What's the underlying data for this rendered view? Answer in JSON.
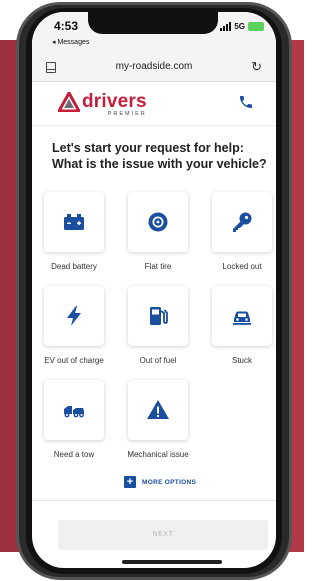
{
  "status": {
    "time": "4:53",
    "back_app": "◂ Messages",
    "network": "5G"
  },
  "browser": {
    "url": "my-roadside.com"
  },
  "brand": {
    "name": "drivers",
    "tagline": "PREMIER",
    "color": "#c41e3a"
  },
  "question": {
    "line1": "Let's start your request for help:",
    "line2": "What is the issue with your vehicle?"
  },
  "options": [
    {
      "label": "Dead battery",
      "icon": "car-battery-icon"
    },
    {
      "label": "Flat tire",
      "icon": "tire-icon"
    },
    {
      "label": "Locked out",
      "icon": "key-icon"
    },
    {
      "label": "EV out of charge",
      "icon": "lightning-bolt-icon"
    },
    {
      "label": "Out of fuel",
      "icon": "fuel-pump-icon"
    },
    {
      "label": "Stuck",
      "icon": "stuck-car-icon"
    },
    {
      "label": "Need a tow",
      "icon": "tow-truck-icon"
    },
    {
      "label": "Mechanical issue",
      "icon": "warning-triangle-icon"
    }
  ],
  "more_options": "MORE OPTIONS",
  "next_button": "NEXT",
  "colors": {
    "icon_blue": "#1a4fa0",
    "background_band": "#b23a48"
  }
}
